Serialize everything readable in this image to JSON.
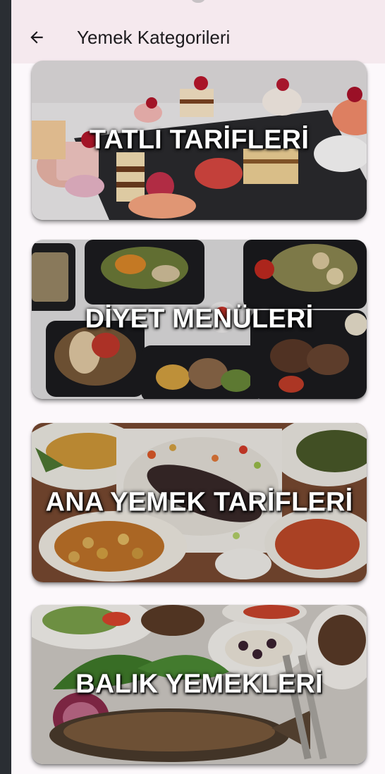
{
  "app_bar": {
    "title": "Yemek Kategorileri",
    "back_icon": "arrow-left-icon"
  },
  "categories": [
    {
      "label": "TATLI TARİFLERİ",
      "image": "desserts-photo"
    },
    {
      "label": "DİYET MENÜLERİ",
      "image": "diet-meals-photo"
    },
    {
      "label": "ANA YEMEK TARİFLERİ",
      "image": "main-dishes-photo"
    },
    {
      "label": "BALIK YEMEKLERİ",
      "image": "fish-dishes-photo"
    }
  ],
  "colors": {
    "app_bar_bg": "#f5e9ee",
    "screen_bg": "#fcf8fb",
    "label_text": "#ffffff"
  }
}
